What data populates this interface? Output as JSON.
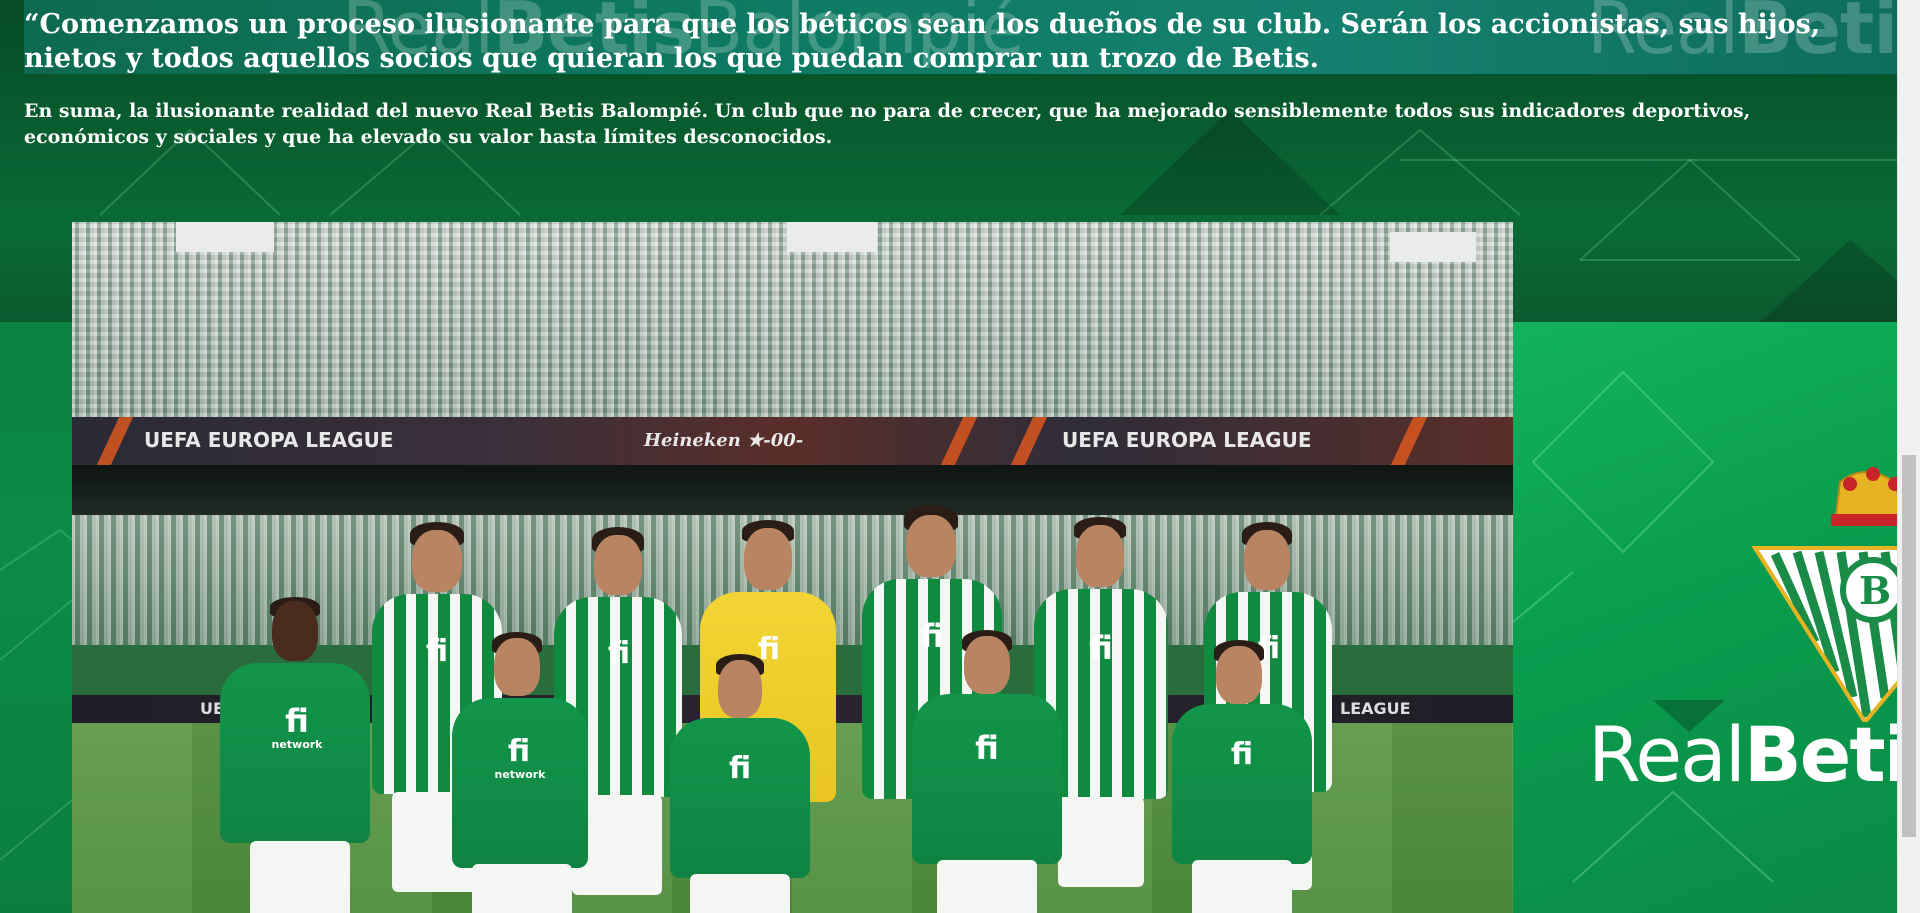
{
  "article": {
    "quote": "“Comenzamos un proceso ilusionante para que los béticos sean los dueños de su club. Serán los accionistas, sus hijos, nietos y todos aquellos socios que quieran los que puedan comprar un trozo de Betis.",
    "summary": "En suma, la ilusionante realidad del nuevo Real Betis Balompié. Un club que no para de crecer, que ha mejorado sensiblemente todos sus indicadores deportivos, económicos y sociales y que ha elevado su valor hasta límites desconocidos."
  },
  "banner": {
    "watermark_left_regular": "Real",
    "watermark_left_bold": "Betis",
    "watermark_left_tail": "Balompié",
    "watermark_right_regular": "Real",
    "watermark_right_bold": "Betis"
  },
  "photo": {
    "ad_board_left": "UEFA EUROPA LEAGUE",
    "ad_board_center": "Heineken ★-00-",
    "ad_board_right": "UEFA EUROPA LEAGUE",
    "lower_board_left": "UEF",
    "lower_board_right": "LEAGUE",
    "sponsor_big": "fi",
    "sponsor_small": "network"
  },
  "side_logo": {
    "text_regular": "Real",
    "text_bold": "Betis"
  },
  "colors": {
    "brand_green": "#0a8c44",
    "banner_teal": "#0e7a63",
    "text": "#ffffff"
  }
}
